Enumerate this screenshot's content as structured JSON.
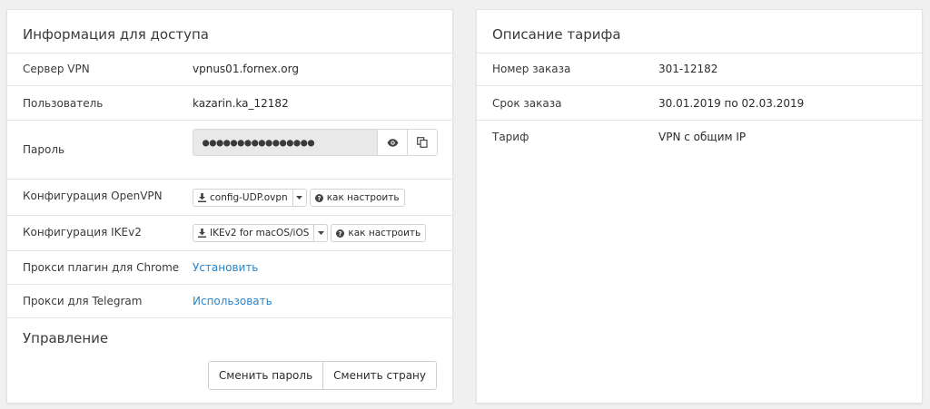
{
  "access": {
    "title": "Информация для доступа",
    "rows": {
      "server": {
        "label": "Сервер VPN",
        "value": "vpnus01.fornex.org"
      },
      "user": {
        "label": "Пользователь",
        "value": "kazarin.ka_12182"
      },
      "password": {
        "label": "Пароль",
        "masked": "●●●●●●●●●●●●●●●●"
      },
      "openvpn": {
        "label": "Конфигурация OpenVPN",
        "file": "config-UDP.ovpn",
        "help": "как настроить"
      },
      "ikev2": {
        "label": "Конфигурация IKEv2",
        "file": "IKEv2 for macOS/iOS",
        "help": "как настроить"
      },
      "chrome": {
        "label": "Прокси плагин для Chrome",
        "link": "Установить"
      },
      "telegram": {
        "label": "Прокси для Telegram",
        "link": "Использовать"
      }
    },
    "management": {
      "title": "Управление",
      "change_password": "Сменить пароль",
      "change_country": "Сменить страну"
    }
  },
  "tariff": {
    "title": "Описание тарифа",
    "rows": {
      "order_number": {
        "label": "Номер заказа",
        "value": "301-12182"
      },
      "order_term": {
        "label": "Срок заказа",
        "value": "30.01.2019 по 02.03.2019"
      },
      "plan": {
        "label": "Тариф",
        "value": "VPN с общим IP"
      }
    }
  },
  "colors": {
    "link": "#2a86c8",
    "background": "#f0f0f0",
    "panel": "#ffffff",
    "field": "#e9e9e9"
  },
  "icons": [
    "eye-icon",
    "copy-icon",
    "download-icon",
    "caret-down-icon",
    "question-circle-icon"
  ]
}
